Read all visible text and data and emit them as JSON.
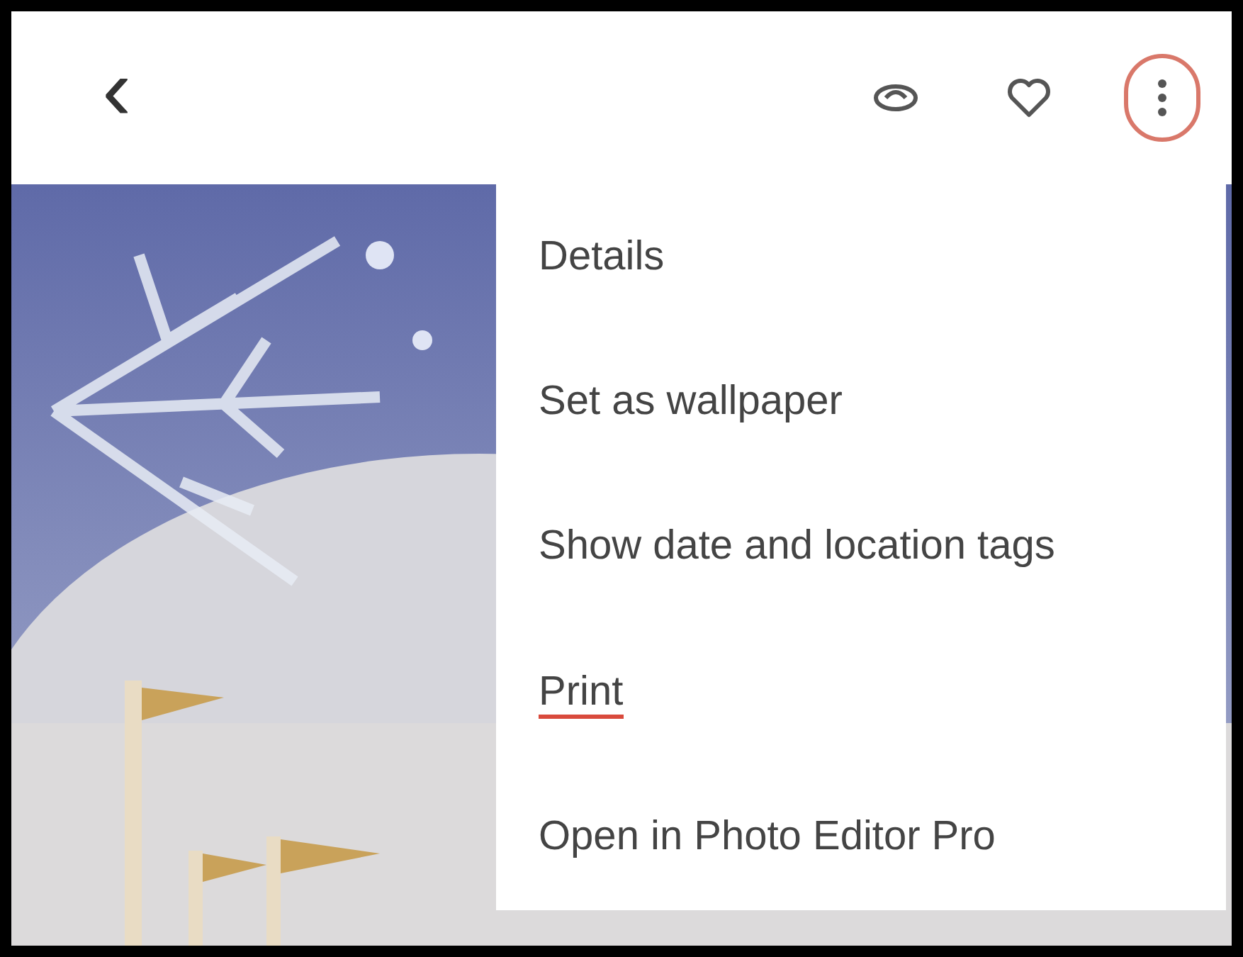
{
  "top_bar": {
    "back": "‹",
    "actions": [
      {
        "kind": "loop",
        "highlighted": false
      },
      {
        "kind": "heart",
        "highlighted": false
      },
      {
        "kind": "more",
        "highlighted": true
      }
    ]
  },
  "menu": {
    "items": [
      {
        "label": "Details",
        "highlighted": false
      },
      {
        "label": "Set as wallpaper",
        "highlighted": false
      },
      {
        "label": "Show date and location tags",
        "highlighted": false
      },
      {
        "label": "Print",
        "highlighted": true
      },
      {
        "label": "Open in Photo Editor Pro",
        "highlighted": false
      }
    ]
  }
}
